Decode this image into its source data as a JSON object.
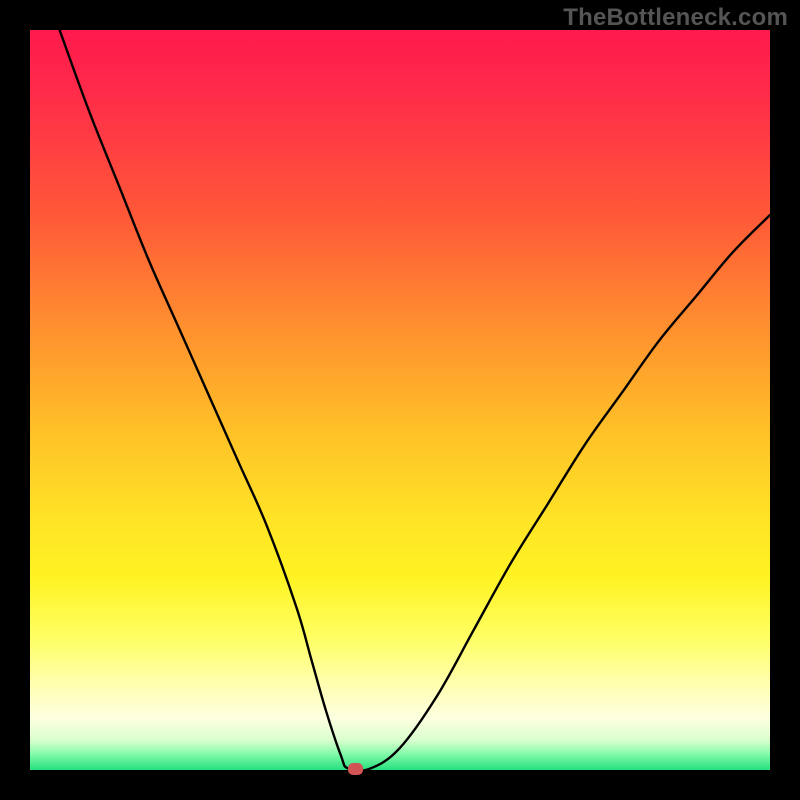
{
  "watermark": "TheBottleneck.com",
  "chart_data": {
    "type": "line",
    "title": "",
    "xlabel": "",
    "ylabel": "",
    "xlim": [
      0,
      100
    ],
    "ylim": [
      0,
      100
    ],
    "grid": false,
    "legend": false,
    "series": [
      {
        "name": "curve",
        "x": [
          4,
          8,
          12,
          16,
          20,
          24,
          28,
          32,
          36,
          38,
          40,
          42,
          43,
          46,
          50,
          55,
          60,
          65,
          70,
          75,
          80,
          85,
          90,
          95,
          100
        ],
        "y": [
          100,
          89,
          79,
          69,
          60,
          51,
          42,
          33,
          22,
          15,
          8,
          2,
          0.2,
          0.2,
          3,
          10,
          19,
          28,
          36,
          44,
          51,
          58,
          64,
          70,
          75
        ]
      }
    ],
    "marker": {
      "x": 44,
      "y": 0.2
    },
    "colors": {
      "curve_stroke": "#000000",
      "marker_fill": "#d35454",
      "gradient_top": "#ff1a4d",
      "gradient_bottom": "#25e07f"
    }
  }
}
